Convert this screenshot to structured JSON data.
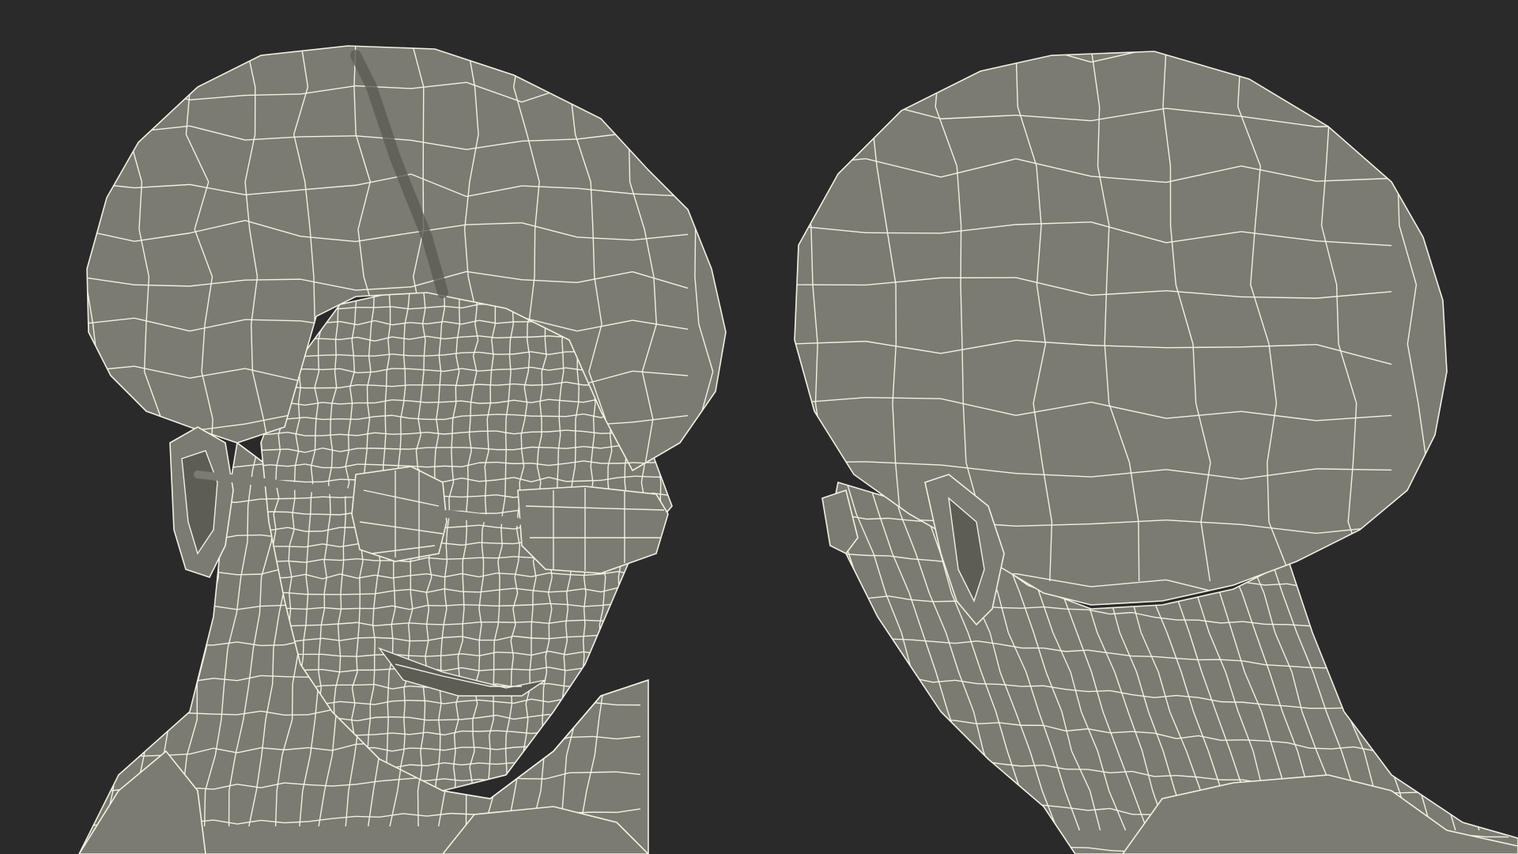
{
  "scene": {
    "background_color": "#2a2a2a",
    "mesh_fill_color": "#7b7b72",
    "mesh_shadow_color": "#5d5d55",
    "wire_color": "#f2f1e6",
    "views": [
      {
        "id": "front-three-quarter",
        "subject": "head-with-glasses-wireframe"
      },
      {
        "id": "back-three-quarter",
        "subject": "head-back-wireframe"
      }
    ]
  }
}
